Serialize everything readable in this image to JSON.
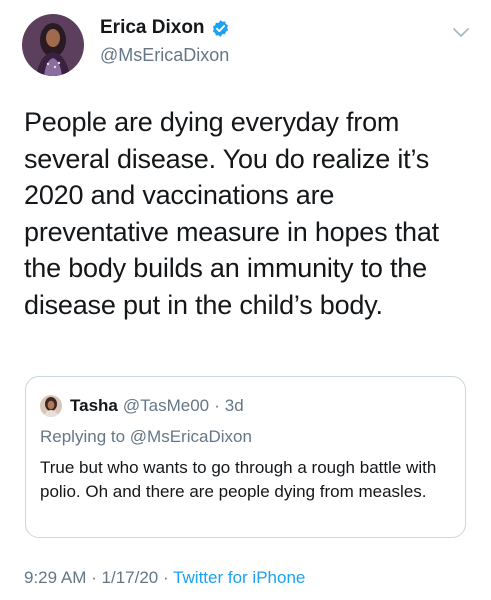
{
  "author": {
    "name": "Erica Dixon",
    "handle": "@MsEricaDixon"
  },
  "icons": {
    "verified": "verified-badge-icon",
    "menu": "chevron-down-icon"
  },
  "tweet": {
    "text": "People are dying everyday from several disease. You do realize it’s 2020 and vaccinations are preventative measure in hopes that the body builds an immunity to the disease put in the child’s body."
  },
  "quote": {
    "name": "Tasha",
    "handle": "@TasMe00",
    "separator": "·",
    "time": "3d",
    "replying_prefix": "Replying to",
    "replying_to": "@MsEricaDixon",
    "text": "True but who wants to go through a rough battle with polio.  Oh and there are people dying from measles."
  },
  "meta": {
    "time": "9:29 AM",
    "sep1": "·",
    "date": "1/17/20",
    "sep2": "·",
    "source": "Twitter for iPhone"
  },
  "colors": {
    "text": "#14171a",
    "secondary": "#657786",
    "link": "#1da1f2",
    "border": "#ccd6dd"
  }
}
